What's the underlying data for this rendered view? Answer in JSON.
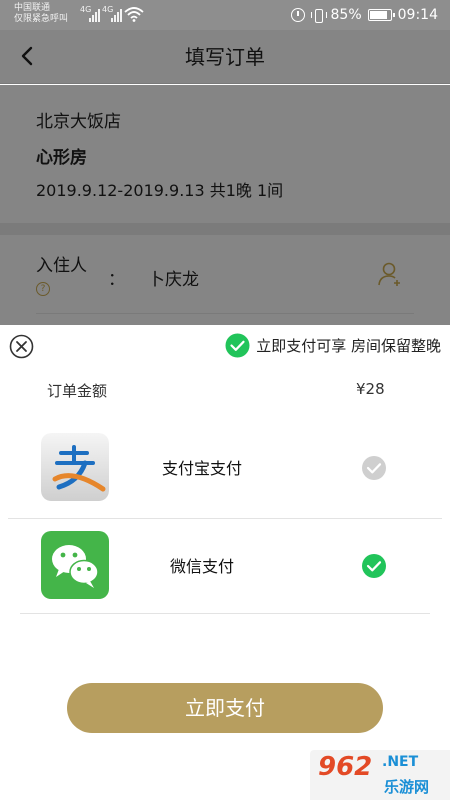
{
  "status_bar": {
    "carrier_line1": "中国联通",
    "carrier_line2": "仅限紧急呼叫",
    "network_1": "4G",
    "network_2": "4G",
    "battery_percent": "85%",
    "battery_level": 0.85,
    "time": "09:14"
  },
  "header": {
    "title": "填写订单",
    "back_icon": "chevron-left-icon"
  },
  "order": {
    "hotel_name": "北京大饭店",
    "room_type": "心形房",
    "dates": "2019.9.12-2019.9.13 共1晚 1间"
  },
  "guest": {
    "label": "入住人",
    "help_mark": "?",
    "colon": "：",
    "name": "卜庆龙",
    "contact_icon": "add-person-icon"
  },
  "payment_sheet": {
    "promo_text": "立即支付可享 房间保留整晚",
    "amount_label": "订单金额",
    "amount_value": "¥28",
    "methods": [
      {
        "name": "支付宝支付",
        "icon": "alipay-logo-icon",
        "selected": false
      },
      {
        "name": "微信支付",
        "icon": "wechat-logo-icon",
        "selected": true
      }
    ],
    "pay_button_label": "立即支付"
  },
  "colors": {
    "accent": "#b79e5f",
    "check_green": "#21c45a",
    "overlay_gray": "#858585"
  },
  "watermark": {
    "brand_number": "962",
    "brand_suffix": ".NET",
    "brand_cn": "乐游网"
  }
}
